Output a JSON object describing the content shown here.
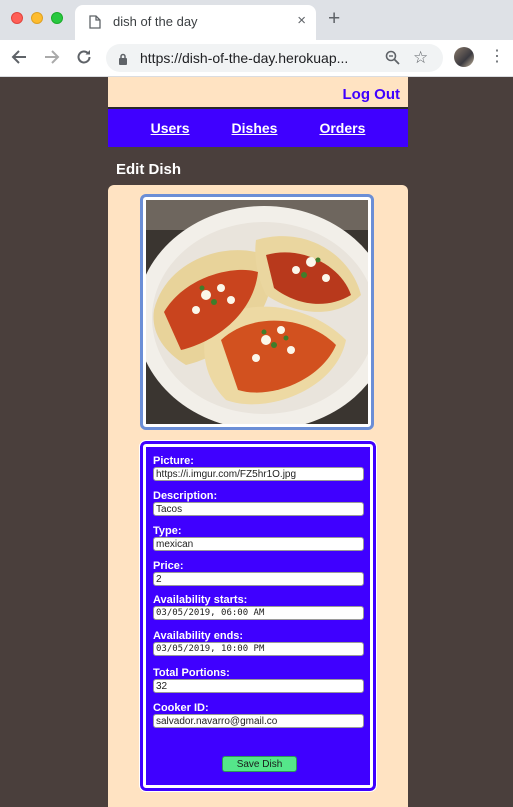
{
  "browser": {
    "tab_title": "dish of the day",
    "tab_close": "×",
    "new_tab": "+",
    "url": "https://dish-of-the-day.herokuap..."
  },
  "header": {
    "logout_label": "Log Out",
    "nav": [
      "Users",
      "Dishes",
      "Orders"
    ]
  },
  "page": {
    "title": "Edit Dish"
  },
  "form": {
    "fields": [
      {
        "label": "Picture:",
        "value": "https://i.imgur.com/FZ5hr1O.jpg"
      },
      {
        "label": "Description:",
        "value": "Tacos"
      },
      {
        "label": "Type:",
        "value": "mexican"
      },
      {
        "label": "Price:",
        "value": "2"
      },
      {
        "label": "Availability starts:",
        "value": "03/05/2019, 06:00 AM"
      },
      {
        "label": "Availability ends:",
        "value": "03/05/2019, 10:00 PM"
      },
      {
        "label": "Total Portions:",
        "value": "32"
      },
      {
        "label": "Cooker ID:",
        "value": "salvador.navarro@gmail.co"
      }
    ],
    "save_label": "Save Dish"
  },
  "colors": {
    "accent": "#3f00ff",
    "card_bg": "#ffe3c2",
    "page_bg": "#4a3f3c",
    "save_button": "#55e68a"
  }
}
